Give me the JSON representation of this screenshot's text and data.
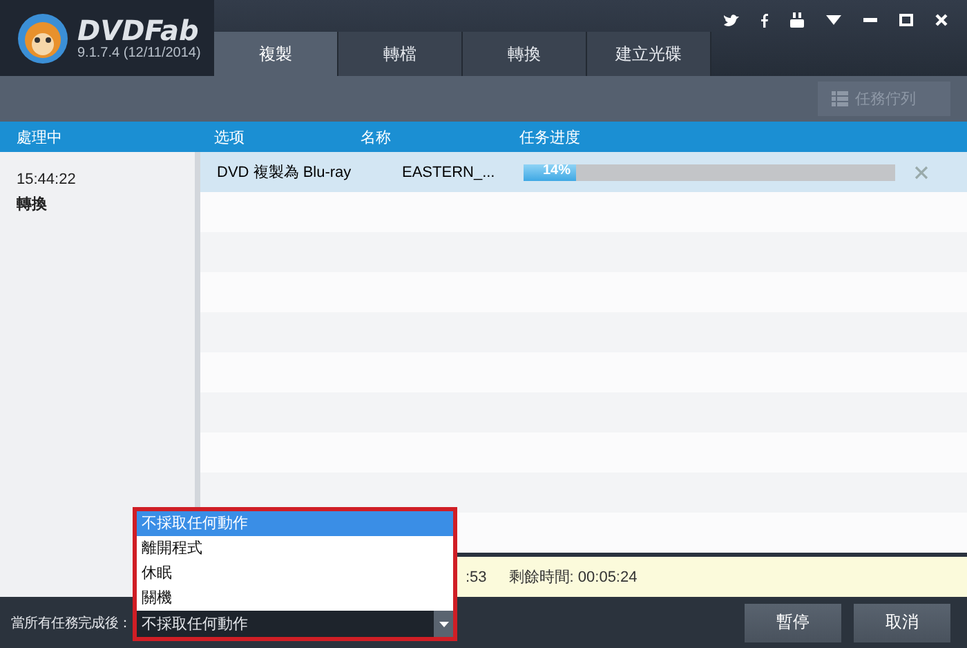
{
  "app": {
    "logo": "DVDFab",
    "version": "9.1.7.4 (12/11/2014)"
  },
  "tabs": [
    {
      "label": "複製",
      "selected": true
    },
    {
      "label": "轉檔",
      "selected": false
    },
    {
      "label": "轉換",
      "selected": false
    },
    {
      "label": "建立光碟",
      "selected": false
    }
  ],
  "toolbar": {
    "queue_button": {
      "label": "任務佇列",
      "disabled": true
    }
  },
  "columns": [
    "處理中",
    "选项",
    "名称",
    "任务进度"
  ],
  "sidebar": {
    "time": "15:44:22",
    "label": "轉換"
  },
  "tasks": [
    {
      "option": "DVD 複製為 Blu-ray",
      "name": "EASTERN_...",
      "level": 0.14,
      "progress_text": "14%",
      "selected": true
    }
  ],
  "status": {
    "elapsed_fragment": ":53",
    "remaining": "剩餘時間: 00:05:24"
  },
  "footer": {
    "label": "當所有任務完成後：",
    "select": {
      "value": "不採取任何動作",
      "expanded": true,
      "options": [
        {
          "label": "不採取任何動作",
          "selected": true
        },
        {
          "label": "離開程式",
          "selected": false
        },
        {
          "label": "休眠",
          "selected": false
        },
        {
          "label": "關機",
          "selected": false
        }
      ]
    },
    "buttons": [
      "暫停",
      "取消"
    ]
  }
}
